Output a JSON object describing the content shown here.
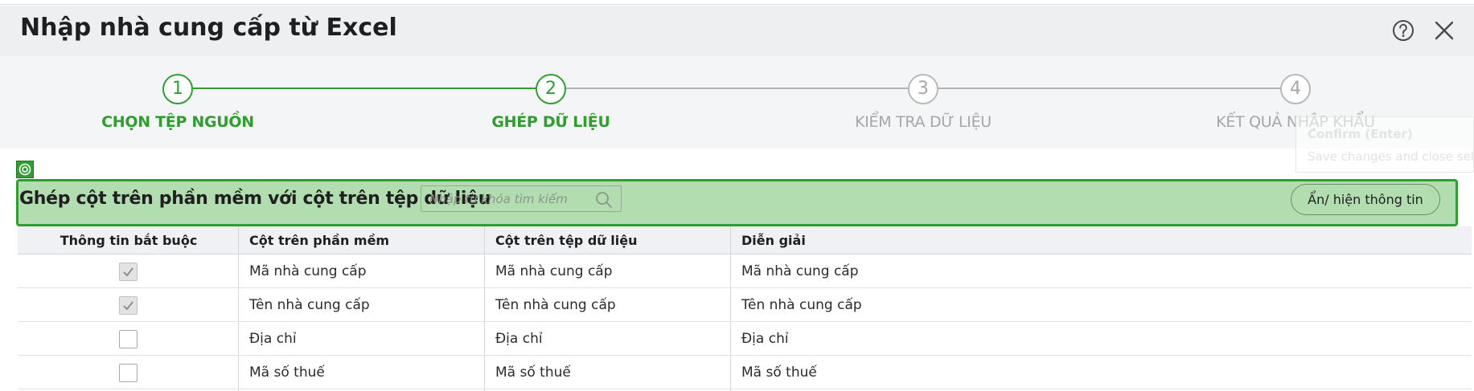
{
  "dialog": {
    "title": "Nhập nhà cung cấp từ Excel"
  },
  "steps": [
    {
      "number": "1",
      "label": "CHỌN TỆP NGUỒN",
      "state": "completed"
    },
    {
      "number": "2",
      "label": "GHÉP DỮ LIỆU",
      "state": "active"
    },
    {
      "number": "3",
      "label": "KIỂM TRA DỮ LIỆU",
      "state": "pending"
    },
    {
      "number": "4",
      "label": "KẾT QUẢ NHẬP KHẨU",
      "state": "pending"
    }
  ],
  "tooltip": {
    "title": "Confirm (Enter)",
    "text": "Save changes and close selection"
  },
  "mapping": {
    "title": "Ghép cột trên phần mềm với cột trên tệp dữ liệu",
    "search_placeholder": "Nhập từ khóa tìm kiếm",
    "toggle_label": "Ẩn/ hiện thông tin"
  },
  "table": {
    "headers": [
      "Thông tin bắt buộc",
      "Cột trên phần mềm",
      "Cột trên tệp dữ liệu",
      "Diễn giải"
    ],
    "rows": [
      {
        "required": true,
        "software_col": "Mã nhà cung cấp",
        "file_col": "Mã nhà cung cấp",
        "description": "Mã nhà cung cấp"
      },
      {
        "required": true,
        "software_col": "Tên nhà cung cấp",
        "file_col": "Tên nhà cung cấp",
        "description": "Tên nhà cung cấp"
      },
      {
        "required": false,
        "software_col": "Địa chỉ",
        "file_col": "Địa chỉ",
        "description": "Địa chỉ"
      },
      {
        "required": false,
        "software_col": "Mã số thuế",
        "file_col": "Mã số thuế",
        "description": "Mã số thuế"
      }
    ]
  },
  "colors": {
    "accent": "#2f9e2f",
    "highlight": "#b2ddb0",
    "inactive": "#a6a6a6"
  }
}
